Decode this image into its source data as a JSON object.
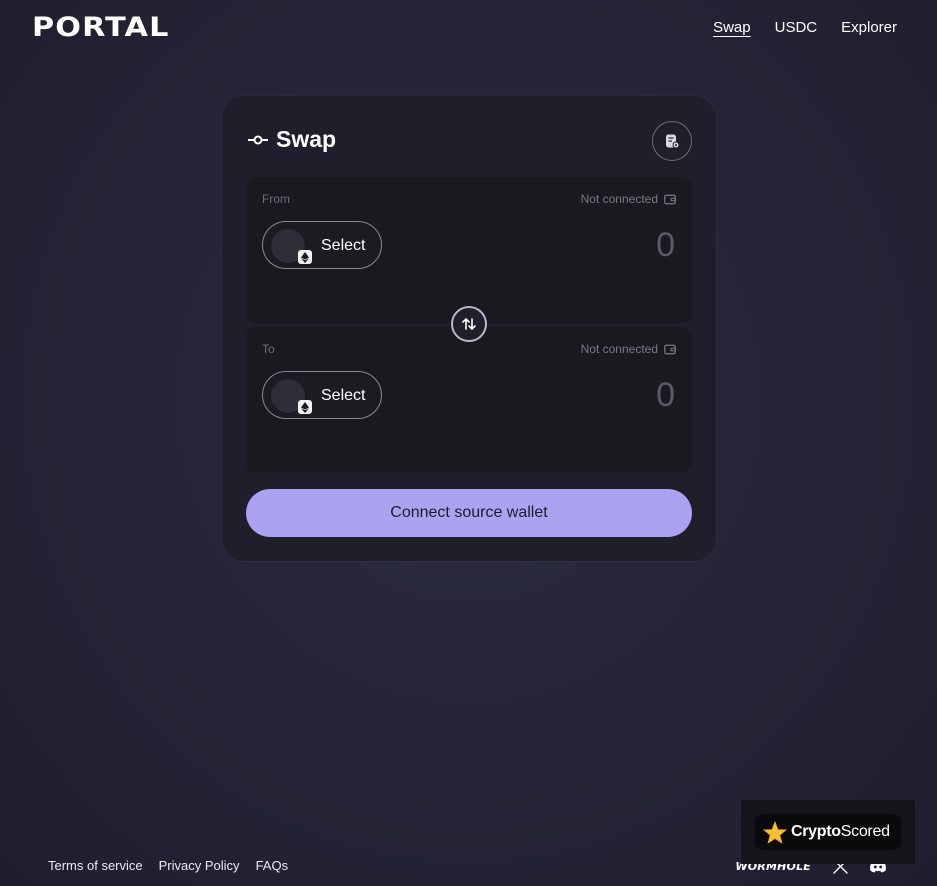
{
  "header": {
    "logo": "PORTAL",
    "nav": [
      {
        "label": "Swap",
        "active": true
      },
      {
        "label": "USDC",
        "active": false
      },
      {
        "label": "Explorer",
        "active": false
      }
    ]
  },
  "swap": {
    "title": "Swap",
    "from": {
      "label": "From",
      "status": "Not connected",
      "select_label": "Select",
      "amount": "0"
    },
    "to": {
      "label": "To",
      "status": "Not connected",
      "select_label": "Select",
      "amount": "0"
    },
    "connect_label": "Connect source wallet"
  },
  "footer": {
    "links": [
      "Terms of service",
      "Privacy Policy",
      "FAQs"
    ],
    "wormhole": "WORMHOLE"
  },
  "badge": {
    "brand_bold": "Crypto",
    "brand_light": "Scored"
  },
  "colors": {
    "accent": "#aba2f2",
    "background": "#252436",
    "card": "#1f1f2b",
    "panel": "#191920"
  },
  "icons": [
    "settings-icon",
    "wallet-icon",
    "ethereum-icon",
    "swap-arrows-icon",
    "x-icon",
    "discord-icon",
    "star-icon",
    "route-icon"
  ]
}
